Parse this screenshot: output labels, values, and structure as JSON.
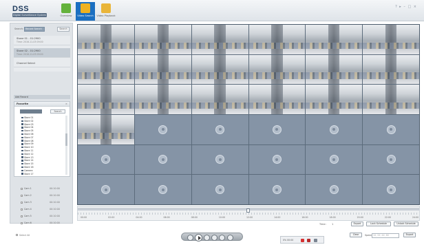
{
  "app": {
    "title": "DSS",
    "subtitle": "Digital Surveillance System"
  },
  "tabs": [
    {
      "label": "Overview",
      "color": "#64b23c"
    },
    {
      "label": "Video Search",
      "color": "#f0b221"
    },
    {
      "label": "Video Playback",
      "color": "#e9b53a"
    }
  ],
  "window_controls": "? ▸ – □ ×",
  "search": {
    "label": "Search:",
    "value": "Record Search",
    "button": "Search"
  },
  "records": [
    {
      "title": "Stone 01 - 01:2900",
      "detail": "Time: 2016-11-03 09:00"
    },
    {
      "title": "Stone 02 - 01:2900",
      "detail": "Time: 2016-11-03 09:00"
    },
    {
      "title": "Channel Select",
      "detail": ""
    }
  ],
  "sub_header": "Add Record",
  "org_panel": {
    "title": "Favorite",
    "search_button": "Search",
    "items": [
      "Store 01",
      "Store 02",
      "Store 03",
      "Store 04",
      "Store 05",
      "Store 06",
      "Store 07",
      "Store 08",
      "Store 09",
      "Store 10",
      "Store 11",
      "Store 12",
      "Store 13",
      "Store 14",
      "Store 15",
      "Store 16",
      "Camera",
      "Store 17"
    ]
  },
  "channels": [
    {
      "name": "Cam 1",
      "time": "00:10:00"
    },
    {
      "name": "Cam 2",
      "time": "00:10:00"
    },
    {
      "name": "Cam 3",
      "time": "00:10:00"
    },
    {
      "name": "Cam 4",
      "time": "00:10:00"
    },
    {
      "name": "Cam 5",
      "time": "00:10:00"
    },
    {
      "name": "Cam 6",
      "time": "00:10:00"
    }
  ],
  "select_all": "Select All",
  "timeline": {
    "ticks": [
      "00:00",
      "02:00",
      "04:00",
      "06:00",
      "08:00",
      "10:00",
      "12:00",
      "14:00",
      "16:00",
      "18:00",
      "20:00",
      "22:00",
      "24:00"
    ]
  },
  "controls": {
    "time_label": "Time:",
    "time_value": "1",
    "buttons": [
      "Export",
      "Lock Schedule",
      "Unlock Schedule"
    ]
  },
  "alarm": {
    "text": "0% 00:00"
  },
  "speed": {
    "button": "Clear",
    "label": "Speed:",
    "value": "1X, 2X, 4X, 8X",
    "go": "Export"
  },
  "grid": {
    "feeds": 19,
    "total": 36
  }
}
